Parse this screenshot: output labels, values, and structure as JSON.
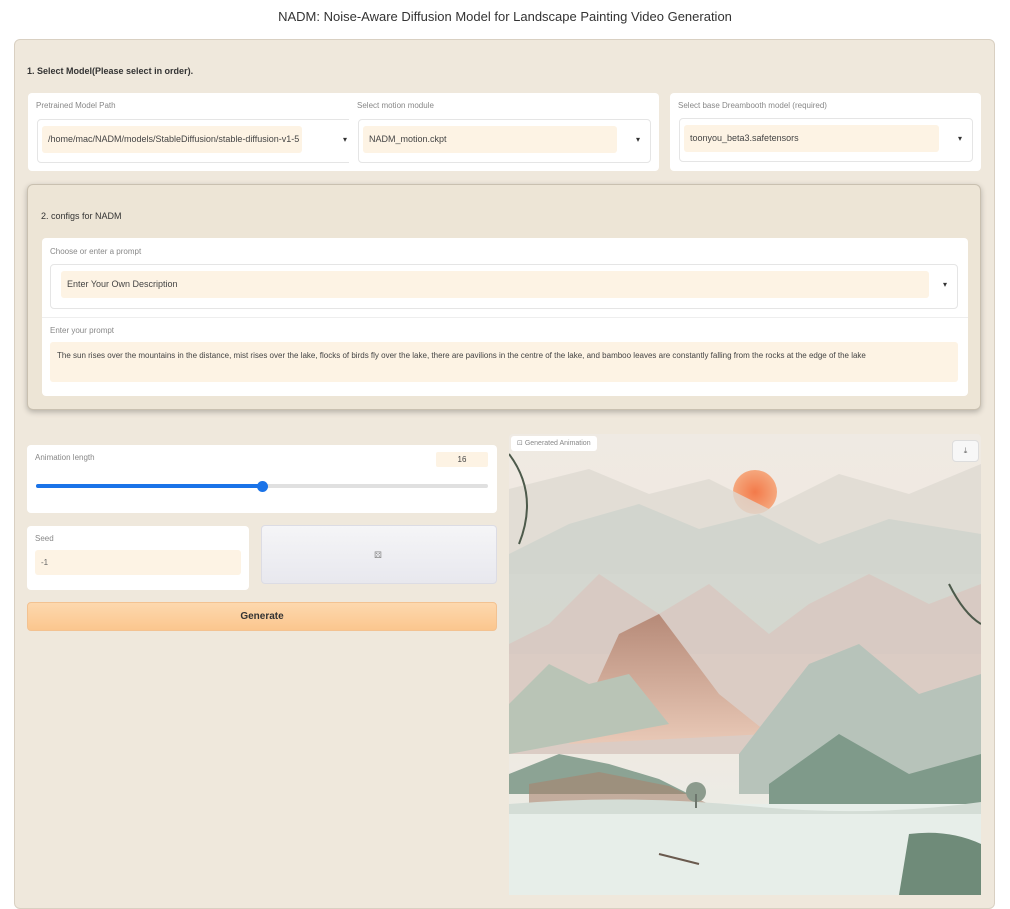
{
  "app": {
    "title": "NADM: Noise-Aware Diffusion Model for Landscape Painting Video Generation"
  },
  "section1": {
    "title": "1. Select Model(Please select in order).",
    "pretrained": {
      "label": "Pretrained Model Path",
      "value": "/home/mac/NADM/models/StableDiffusion/stable-diffusion-v1-5"
    },
    "motion": {
      "label": "Select motion module",
      "value": "NADM_motion.ckpt"
    },
    "dreambooth": {
      "label": "Select base Dreambooth model (required)",
      "value": "toonyou_beta3.safetensors"
    }
  },
  "section2": {
    "title": "2. configs for NADM",
    "prompt_choice": {
      "label": "Choose or enter a prompt",
      "value": "Enter Your Own Description"
    },
    "prompt": {
      "label": "Enter your prompt",
      "value": "The sun rises over the mountains in the distance, mist rises over the lake, flocks of birds fly over the lake, there are pavilions in the centre of the lake, and bamboo leaves are constantly falling from the rocks at the edge of the lake"
    }
  },
  "animation_length": {
    "label": "Animation length",
    "value": "16",
    "fraction": 0.5
  },
  "seed": {
    "label": "Seed",
    "value": "-1"
  },
  "dice_icon": "dice-icon",
  "generate_label": "Generate",
  "output": {
    "label": "Generated Animation",
    "film_icon": "film-icon",
    "download_icon": "download-icon"
  },
  "colors": {
    "accent": "#1a73e8",
    "button": "#fbc68e",
    "panel": "#efe8dc",
    "input": "#fdf3e4"
  }
}
